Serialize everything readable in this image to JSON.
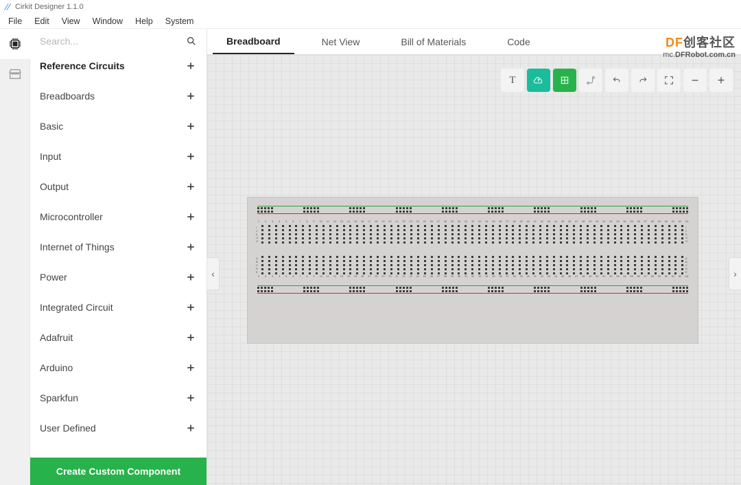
{
  "app": {
    "title": "Cirkit Designer 1.1.0"
  },
  "menus": [
    "File",
    "Edit",
    "View",
    "Window",
    "Help",
    "System"
  ],
  "search": {
    "placeholder": "Search..."
  },
  "categories": [
    {
      "label": "Reference Circuits",
      "selected": true
    },
    {
      "label": "Breadboards"
    },
    {
      "label": "Basic"
    },
    {
      "label": "Input"
    },
    {
      "label": "Output"
    },
    {
      "label": "Microcontroller"
    },
    {
      "label": "Internet of Things"
    },
    {
      "label": "Power"
    },
    {
      "label": "Integrated Circuit"
    },
    {
      "label": "Adafruit"
    },
    {
      "label": "Arduino"
    },
    {
      "label": "Sparkfun"
    },
    {
      "label": "User Defined"
    }
  ],
  "sidebar": {
    "create_button": "Create Custom Component"
  },
  "tabs": [
    {
      "label": "Breadboard",
      "active": true
    },
    {
      "label": "Net View"
    },
    {
      "label": "Bill of Materials"
    },
    {
      "label": "Code"
    }
  ],
  "toolbar": {
    "text": "T",
    "upload": "cloud-upload",
    "grid": "grid",
    "route": "route",
    "undo": "undo",
    "redo": "redo",
    "fullscreen": "fullscreen",
    "zoom_out": "−",
    "zoom_in": "+"
  },
  "breadboard": {
    "columns": 63,
    "rows_top_labels": [
      "I",
      "J",
      "K",
      "G",
      "H"
    ],
    "rows_bottom_labels": [
      "A",
      "B",
      "C",
      "D",
      "E"
    ],
    "rail_group_size": 5,
    "rail_groups": 10
  },
  "watermark": {
    "line1_prefix": "DF",
    "line1_suffix": "创客社区",
    "line2": "mc.DFRobot.com.cn",
    "line2_short": "DFRobot.com.cn"
  }
}
